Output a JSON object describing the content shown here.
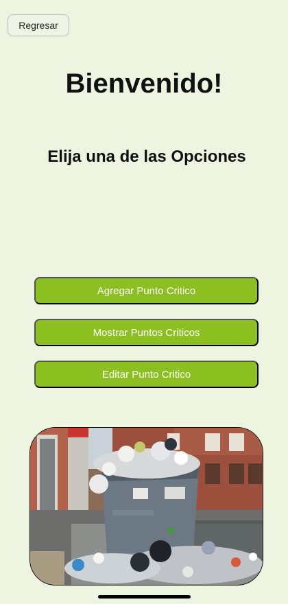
{
  "header": {
    "back_label": "Regresar"
  },
  "main": {
    "title": "Bienvenido!",
    "subtitle": "Elija una de las Opciones",
    "options": [
      "Agregar Punto Critico",
      "Mostrar Puntos Criticos",
      "Editar Punto Critico"
    ]
  },
  "colors": {
    "background": "#edf5e1",
    "accent": "#8cc021"
  },
  "image": {
    "content": "overflowing-trash-bin-street-photo"
  }
}
